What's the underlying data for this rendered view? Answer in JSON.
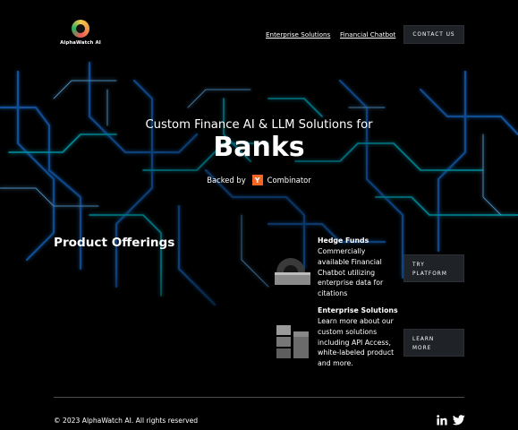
{
  "brand": {
    "name": "AlphaWatch AI"
  },
  "nav": {
    "links": [
      "Enterprise Solutions",
      "Financial Chatbot"
    ],
    "contact_label": "CONTACT US"
  },
  "hero": {
    "subtitle": "Custom Finance AI & LLM Solutions for",
    "title": "Banks",
    "backed_by": "Backed by",
    "yc_letter": "Y",
    "yc_name": "Combinator"
  },
  "products": {
    "heading": "Product Offerings",
    "items": [
      {
        "title": "Hedge Funds",
        "description": "Commercially available Financial Chatbot utilizing enterprise data for citations",
        "button": "TRY PLATFORM",
        "icon": "chatbot-icon"
      },
      {
        "title": "Enterprise Solutions",
        "description": "Learn more about our custom solutions including API Access, white-labeled product and more.",
        "button": "LEARN MORE",
        "icon": "layout-grid-icon"
      }
    ]
  },
  "footer": {
    "copyright": "© 2023 AlphaWatch AI. All rights reserved",
    "social": [
      "linkedin-icon",
      "twitter-icon"
    ]
  },
  "colors": {
    "background": "#000000",
    "button_bg": "#1f2226",
    "yc_orange": "#f26522",
    "circuit_blue": "#1e90ff"
  }
}
